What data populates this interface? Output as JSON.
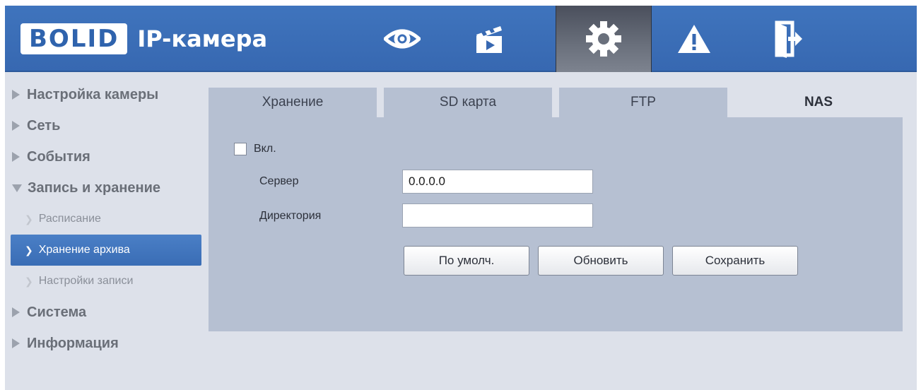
{
  "header": {
    "logo": "BOLID",
    "product": "IP-камера",
    "nav": [
      {
        "name": "live-view",
        "icon": "eye-icon"
      },
      {
        "name": "playback",
        "icon": "clapperboard-icon"
      },
      {
        "name": "settings",
        "icon": "gear-icon",
        "active": true
      },
      {
        "name": "alarm",
        "icon": "warning-icon"
      },
      {
        "name": "logout",
        "icon": "exit-door-icon"
      }
    ]
  },
  "sidebar": {
    "items": [
      {
        "label": "Настройка камеры"
      },
      {
        "label": "Сеть"
      },
      {
        "label": "События"
      },
      {
        "label": "Запись и хранение",
        "open": true,
        "children": [
          {
            "label": "Расписание"
          },
          {
            "label": "Хранение архива",
            "active": true
          },
          {
            "label": "Настройки записи"
          }
        ]
      },
      {
        "label": "Система"
      },
      {
        "label": "Информация"
      }
    ]
  },
  "tabs": [
    {
      "label": "Хранение"
    },
    {
      "label": "SD карта"
    },
    {
      "label": "FTP"
    },
    {
      "label": "NAS",
      "active": true
    }
  ],
  "form": {
    "enable_label": "Вкл.",
    "enable_checked": false,
    "server_label": "Сервер",
    "server_value": "0.0.0.0",
    "directory_label": "Директория",
    "directory_value": "",
    "default_button": "По умолч.",
    "refresh_button": "Обновить",
    "save_button": "Сохранить"
  },
  "colors": {
    "header": "#3768b1",
    "active_nav": "#6a707c",
    "sidebar_active": "#3a6db5",
    "panel": "#b6c0d2",
    "background": "#dde1ea"
  }
}
